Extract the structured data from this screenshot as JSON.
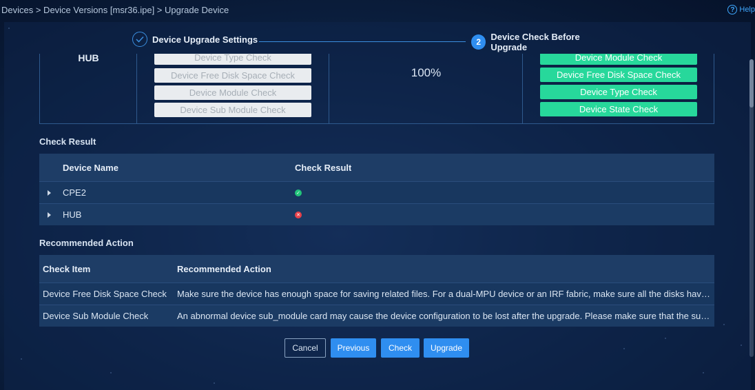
{
  "breadcrumb": "Devices > Device Versions [msr36.ipe] > Upgrade Device",
  "help": {
    "label": "Help"
  },
  "steps": [
    {
      "number": "1",
      "label": "Device Upgrade Settings",
      "state": "done"
    },
    {
      "number": "2",
      "label": "Device Check Before Upgrade",
      "state": "active"
    }
  ],
  "upgrade_check": {
    "device": "HUB",
    "pending_items": [
      "Device Type Check",
      "Device Free Disk Space Check",
      "Device Module Check",
      "Device Sub Module Check"
    ],
    "progress": "100%",
    "passed_items": [
      "Device Module Check",
      "Device Free Disk Space Check",
      "Device Type Check",
      "Device State Check"
    ]
  },
  "check_result": {
    "title": "Check Result",
    "columns": [
      "Device Name",
      "Check Result"
    ],
    "rows": [
      {
        "device": "CPE2",
        "status": "success"
      },
      {
        "device": "HUB",
        "status": "failed"
      }
    ]
  },
  "recommended": {
    "title": "Recommended Action",
    "columns": [
      "Check Item",
      "Recommended Action"
    ],
    "rows": [
      {
        "item": "Device Free Disk Space Check",
        "action": "Make sure the device has enough space for saving related files. For a dual-MPU device or an IRF fabric, make sure all the disks have suf..."
      },
      {
        "item": "Device Sub Module Check",
        "action": "An abnormal device sub_module card may cause the device configuration to be lost after the upgrade. Please make sure that the sub_..."
      }
    ]
  },
  "buttons": {
    "cancel": "Cancel",
    "previous": "Previous",
    "check": "Check",
    "upgrade": "Upgrade"
  },
  "colors": {
    "accent": "#2f8ef0",
    "pass": "#27d89b",
    "success": "#22c47a",
    "error": "#e8414a"
  }
}
